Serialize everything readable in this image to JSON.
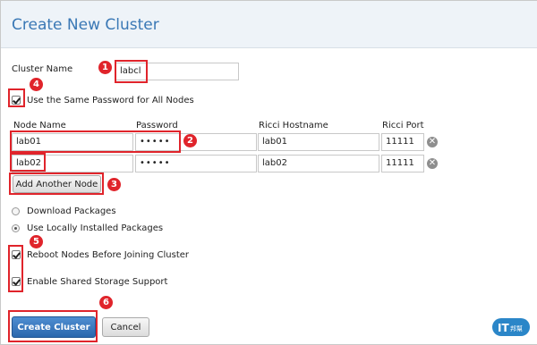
{
  "dialog": {
    "title": "Create New Cluster",
    "cluster_name_label": "Cluster Name",
    "cluster_name_value": "labcl",
    "same_password_label": "Use the Same Password for All Nodes",
    "same_password_checked": true
  },
  "node_table": {
    "headers": [
      "Node Name",
      "Password",
      "Ricci Hostname",
      "Ricci Port"
    ],
    "rows": [
      {
        "node_name": "lab01",
        "password": "•••••",
        "ricci_hostname": "lab01",
        "ricci_port": "11111"
      },
      {
        "node_name": "lab02",
        "password": "•••••",
        "ricci_hostname": "lab02",
        "ricci_port": "11111"
      }
    ],
    "add_node_label": "Add Another Node"
  },
  "packages": {
    "download_label": "Download Packages",
    "local_label": "Use Locally Installed Packages",
    "selected": "local"
  },
  "options": {
    "reboot_label": "Reboot Nodes Before Joining Cluster",
    "reboot_checked": true,
    "shared_storage_label": "Enable Shared Storage Support",
    "shared_storage_checked": true
  },
  "buttons": {
    "create_label": "Create Cluster",
    "cancel_label": "Cancel"
  },
  "annotations": [
    "1",
    "2",
    "3",
    "4",
    "5",
    "6"
  ],
  "watermark": {
    "text": "IT邦幫忙"
  },
  "colors": {
    "title": "#3a78b5",
    "annotation": "#e0242b",
    "primary_button": "#2a67ad",
    "header_bg": "#eef3f8"
  }
}
